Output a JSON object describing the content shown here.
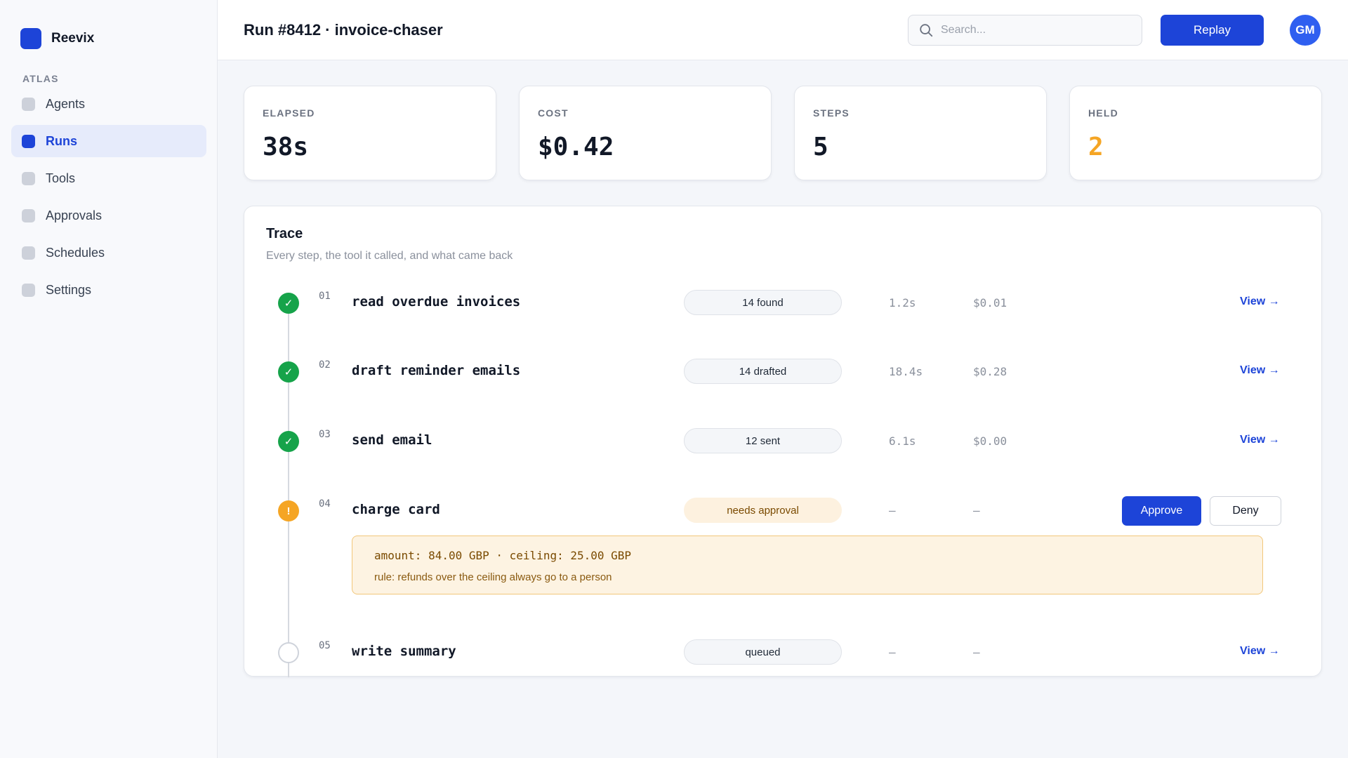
{
  "app": {
    "name": "Reevix"
  },
  "sidebar": {
    "section": "ATLAS",
    "items": [
      {
        "label": "Agents"
      },
      {
        "label": "Runs"
      },
      {
        "label": "Tools"
      },
      {
        "label": "Approvals"
      },
      {
        "label": "Schedules"
      },
      {
        "label": "Settings"
      }
    ]
  },
  "header": {
    "title": "Run #8412 · invoice-chaser",
    "search_placeholder": "Search...",
    "replay_label": "Replay",
    "avatar_initials": "GM"
  },
  "stats": [
    {
      "label": "ELAPSED",
      "value": "38s"
    },
    {
      "label": "COST",
      "value": "$0.42"
    },
    {
      "label": "STEPS",
      "value": "5"
    },
    {
      "label": "HELD",
      "value": "2"
    }
  ],
  "colors": {
    "accent": "#1d44d8",
    "done": "#16a34a",
    "held": "#f5a524"
  },
  "trace": {
    "title": "Trace",
    "subtitle": "Every step, the tool it called, and what came back",
    "view_label": "View →",
    "approve_label": "Approve",
    "deny_label": "Deny",
    "steps": [
      {
        "num": "01",
        "name": "read overdue invoices",
        "badge": "14 found",
        "time": "1.2s",
        "cost": "$0.01",
        "status": "done",
        "icon": "check-icon",
        "glyph": "✓"
      },
      {
        "num": "02",
        "name": "draft reminder emails",
        "badge": "14 drafted",
        "time": "18.4s",
        "cost": "$0.28",
        "status": "done",
        "icon": "check-icon",
        "glyph": "✓"
      },
      {
        "num": "03",
        "name": "send email",
        "badge": "12 sent",
        "time": "6.1s",
        "cost": "$0.00",
        "status": "done",
        "icon": "check-icon",
        "glyph": "✓"
      },
      {
        "num": "04",
        "name": "charge card",
        "badge": "needs approval",
        "time": "–",
        "cost": "–",
        "status": "held",
        "icon": "exclamation-icon",
        "glyph": "!"
      },
      {
        "num": "05",
        "name": "write summary",
        "badge": "queued",
        "time": "–",
        "cost": "–",
        "status": "queued",
        "icon": "empty-circle-icon",
        "glyph": ""
      }
    ],
    "held_detail": {
      "line1": "amount: 84.00 GBP · ceiling: 25.00 GBP",
      "line2": "rule: refunds over the ceiling always go to a person"
    }
  }
}
